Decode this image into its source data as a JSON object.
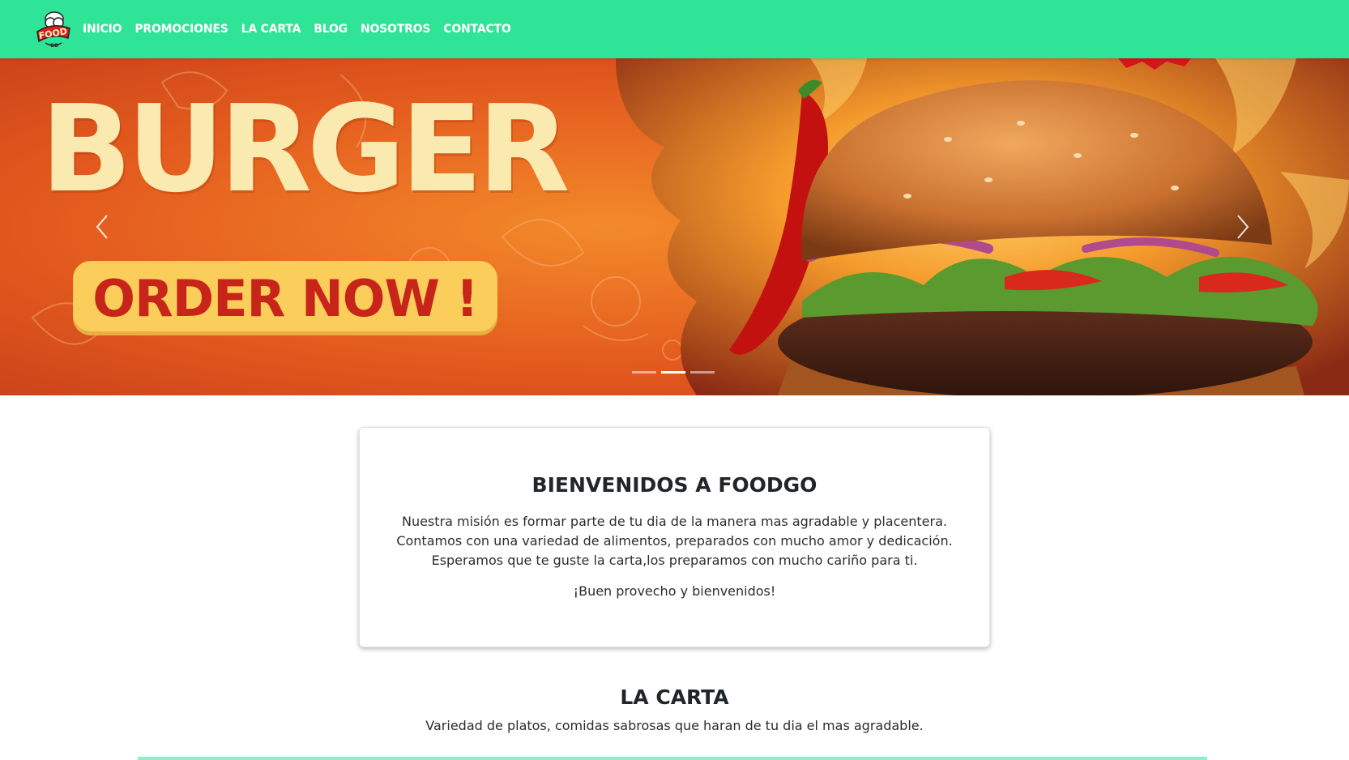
{
  "navbar": {
    "logo_text": "FOOD GO",
    "links": [
      "INICIO",
      "PROMOCIONES",
      "LA CARTA",
      "BLOG",
      "NOSOTROS",
      "CONTACTO"
    ]
  },
  "hero": {
    "title": "BURGER",
    "cta": "ORDER NOW !",
    "active_slide": 1,
    "slide_count": 3
  },
  "welcome": {
    "title": "BIENVENIDOS A FOODGO",
    "lines": [
      "Nuestra misión es formar parte de tu dia de la manera mas agradable y placentera.",
      "Contamos con una variedad de alimentos, preparados con mucho amor y dedicación.",
      "Esperamos que te guste la carta,los preparamos con mucho cariño para ti."
    ],
    "closing": "¡Buen provecho y bienvenidos!"
  },
  "carta": {
    "title": "LA CARTA",
    "subtitle": "Variedad de platos, comidas sabrosas que haran de tu dia el mas agradable."
  },
  "colors": {
    "navbar": "#2fe397",
    "hero_bg": "#e0541c",
    "hero_title": "#fbeab0",
    "cta_bg": "#fbcd5a",
    "cta_text": "#c8251a"
  }
}
